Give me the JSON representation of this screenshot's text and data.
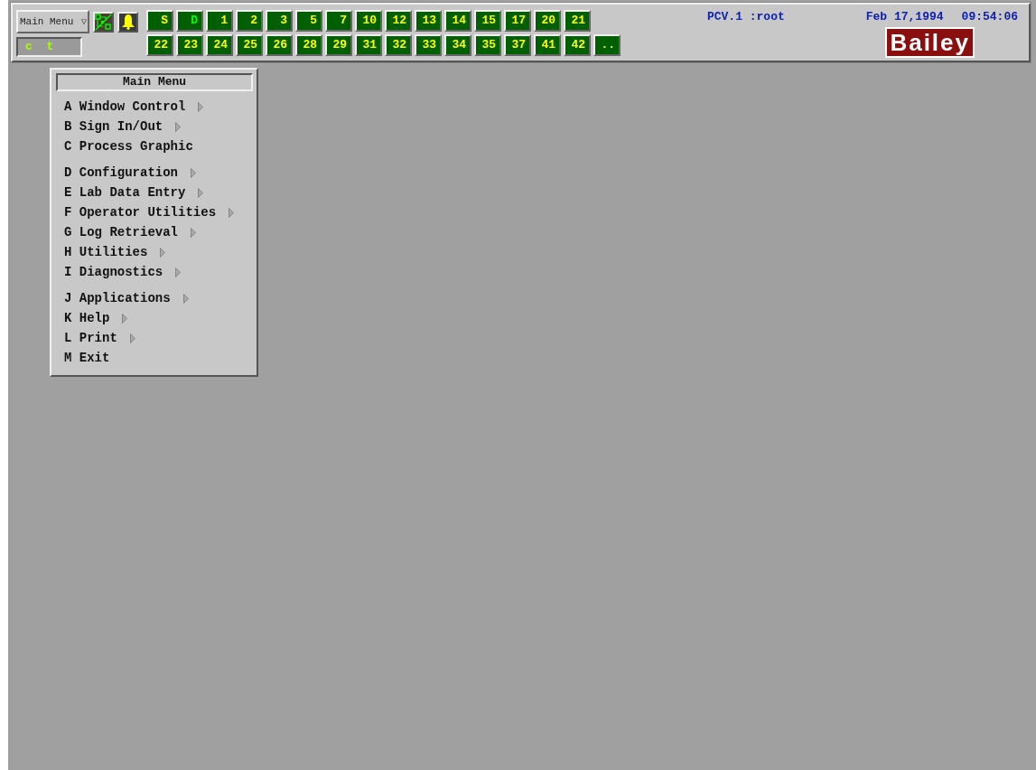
{
  "toolbar": {
    "menu_selector": {
      "label": "Main Menu",
      "arrow": "▽"
    },
    "status_field": "c  t",
    "key_rows": [
      [
        {
          "label": "S",
          "active": false
        },
        {
          "label": "D",
          "active": true
        },
        {
          "label": "1",
          "active": false
        },
        {
          "label": "2",
          "active": false
        },
        {
          "label": "3",
          "active": false
        },
        {
          "label": "5",
          "active": false
        },
        {
          "label": "7",
          "active": false
        },
        {
          "label": "10",
          "active": false
        },
        {
          "label": "12",
          "active": false
        },
        {
          "label": "13",
          "active": false
        },
        {
          "label": "14",
          "active": false
        },
        {
          "label": "15",
          "active": false
        },
        {
          "label": "17",
          "active": false
        },
        {
          "label": "20",
          "active": false
        },
        {
          "label": "21",
          "active": false
        }
      ],
      [
        {
          "label": "22",
          "active": false
        },
        {
          "label": "23",
          "active": false
        },
        {
          "label": "24",
          "active": false
        },
        {
          "label": "25",
          "active": false
        },
        {
          "label": "26",
          "active": false
        },
        {
          "label": "28",
          "active": false
        },
        {
          "label": "29",
          "active": false
        },
        {
          "label": "31",
          "active": false
        },
        {
          "label": "32",
          "active": false
        },
        {
          "label": "33",
          "active": false
        },
        {
          "label": "34",
          "active": false
        },
        {
          "label": "35",
          "active": false
        },
        {
          "label": "37",
          "active": false
        },
        {
          "label": "41",
          "active": false
        },
        {
          "label": "42",
          "active": false
        },
        {
          "label": "..",
          "active": false
        }
      ]
    ],
    "console": "PCV.1 :root",
    "date": "Feb 17,1994",
    "time": "09:54:06",
    "logo": "Bailey"
  },
  "main_menu": {
    "title": "Main Menu",
    "groups": [
      [
        {
          "key": "A",
          "label": "Window Control",
          "submenu": true
        },
        {
          "key": "B",
          "label": "Sign In/Out",
          "submenu": true
        },
        {
          "key": "C",
          "label": "Process Graphic",
          "submenu": false
        }
      ],
      [
        {
          "key": "D",
          "label": "Configuration",
          "submenu": true
        },
        {
          "key": "E",
          "label": "Lab Data Entry",
          "submenu": true
        },
        {
          "key": "F",
          "label": "Operator Utilities",
          "submenu": true
        },
        {
          "key": "G",
          "label": "Log Retrieval",
          "submenu": true
        },
        {
          "key": "H",
          "label": "Utilities",
          "submenu": true
        },
        {
          "key": "I",
          "label": "Diagnostics",
          "submenu": true
        }
      ],
      [
        {
          "key": "J",
          "label": "Applications",
          "submenu": true
        },
        {
          "key": "K",
          "label": "Help",
          "submenu": true
        },
        {
          "key": "L",
          "label": "Print",
          "submenu": true
        },
        {
          "key": "M",
          "label": "Exit",
          "submenu": false
        }
      ]
    ]
  }
}
